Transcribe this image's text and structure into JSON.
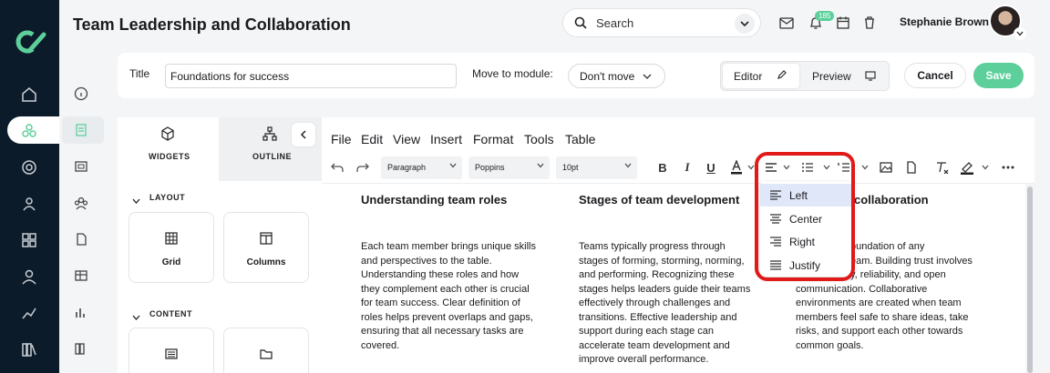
{
  "page": {
    "title": "Team Leadership and Collaboration"
  },
  "header": {
    "search_placeholder": "Search",
    "notification_count": "185",
    "user_name": "Stephanie Brown"
  },
  "form": {
    "title_label": "Title",
    "title_value": "Foundations for success",
    "move_label": "Move to module:",
    "move_value": "Don't move",
    "editor_label": "Editor",
    "preview_label": "Preview",
    "cancel_label": "Cancel",
    "save_label": "Save"
  },
  "panel": {
    "tabs": [
      "WIDGETS",
      "OUTLINE"
    ],
    "layout_section": "LAYOUT",
    "layout_items": [
      "Grid",
      "Columns"
    ],
    "content_section": "CONTENT"
  },
  "editor": {
    "menu": [
      "File",
      "Edit",
      "View",
      "Insert",
      "Format",
      "Tools",
      "Table"
    ],
    "block_format": "Paragraph",
    "font_family": "Poppins",
    "font_size": "10pt",
    "align_options": [
      "Left",
      "Center",
      "Right",
      "Justify"
    ],
    "selected_align": "Left"
  },
  "document": {
    "columns": [
      {
        "heading": "Understanding team roles",
        "lines": [
          "Each team member brings unique skills",
          "and perspectives to the table.",
          "Understanding these roles and how",
          "they complement each other is crucial",
          "for team success. Clear definition of",
          "roles helps prevent overlaps and gaps,",
          "ensuring that all necessary tasks are",
          "covered."
        ]
      },
      {
        "heading": "Stages of team development",
        "lines": [
          "Teams typically progress through",
          "stages of forming, storming, norming,",
          "and performing. Recognizing these",
          "stages helps leaders guide their teams",
          "effectively through challenges and",
          "transitions. Effective leadership and",
          "support during each stage can",
          "accelerate team development and",
          "improve overall performance."
        ]
      },
      {
        "heading": "collaboration",
        "lines": [
          "oundation of any",
          "eam. Building trust involves",
          "y, reliability, and open",
          "communication. Collaborative",
          "environments are created when team",
          "members feel safe to share ideas, take",
          "risks, and support each other towards",
          "common goals."
        ]
      }
    ]
  },
  "colors": {
    "sidebar": "#0c1b2a",
    "accent": "#5ccf9a",
    "highlight": "#e01919"
  }
}
